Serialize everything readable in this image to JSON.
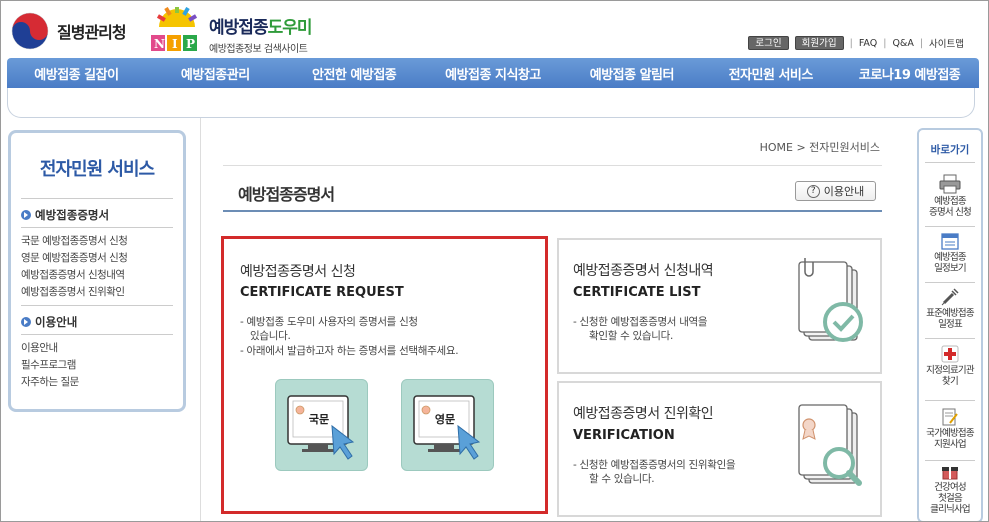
{
  "header": {
    "org_name": "질병관리청",
    "site_title_a": "예방접종",
    "site_title_b": "도우미",
    "site_subtitle": "예방접종정보 검색사이트",
    "login": "로그인",
    "join": "회원가입",
    "faq": "FAQ",
    "qna": "Q&A",
    "sitemap": "사이트맵"
  },
  "gnb": [
    "예방접종 길잡이",
    "예방접종관리",
    "안전한 예방접종",
    "예방접종 지식창고",
    "예방접종 알림터",
    "전자민원 서비스",
    "코로나19 예방접종"
  ],
  "lnb": {
    "title": "전자민원 서비스",
    "section1": "예방접종증명서",
    "links1": [
      "국문 예방접종증명서 신청",
      "영문 예방접종증명서 신청",
      "예방접종증명서 신청내역",
      "예방접종증명서 진위확인"
    ],
    "section2": "이용안내",
    "links2": [
      "이용안내",
      "필수프로그램",
      "자주하는 질문"
    ]
  },
  "content": {
    "breadcrumb": "HOME > 전자민원서비스",
    "page_title": "예방접종증명서",
    "guide_button": "이용안내",
    "request": {
      "title": "예방접종증명서 신청",
      "subtitle": "CERTIFICATE REQUEST",
      "desc1": "- 예방접종 도우미 사용자의 증명서를 신청",
      "desc1b": "있습니다.",
      "desc2": "- 아래에서 발급하고자 하는 증명서를 선택해주세요.",
      "korean_label": "국문",
      "english_label": "영문"
    },
    "list": {
      "title": "예방접종증명서 신청내역",
      "subtitle": "CERTIFICATE LIST",
      "desc1": "- 신청한 예방접종증명서 내역을",
      "desc2": "확인할 수 있습니다."
    },
    "verify": {
      "title": "예방접종증명서 진위확인",
      "subtitle": "VERIFICATION",
      "desc1": "- 신청한 예방접종증명서의 진위확인을",
      "desc2": "할 수 있습니다."
    }
  },
  "quick": {
    "title": "바로가기",
    "items": [
      [
        "예방접종",
        "증명서 신청"
      ],
      [
        "예방접종",
        "일정보기"
      ],
      [
        "표준예방접종",
        "일정표"
      ],
      [
        "지정의료기관",
        "찾기"
      ],
      [
        "국가예방접종",
        "지원사업"
      ],
      [
        "건강여성",
        "첫걸음",
        "클리닉사업"
      ]
    ]
  },
  "colors": {
    "accent": "#4a7cc6",
    "highlight_border": "#d32a2a",
    "button_teal": "#b6dcd3"
  }
}
